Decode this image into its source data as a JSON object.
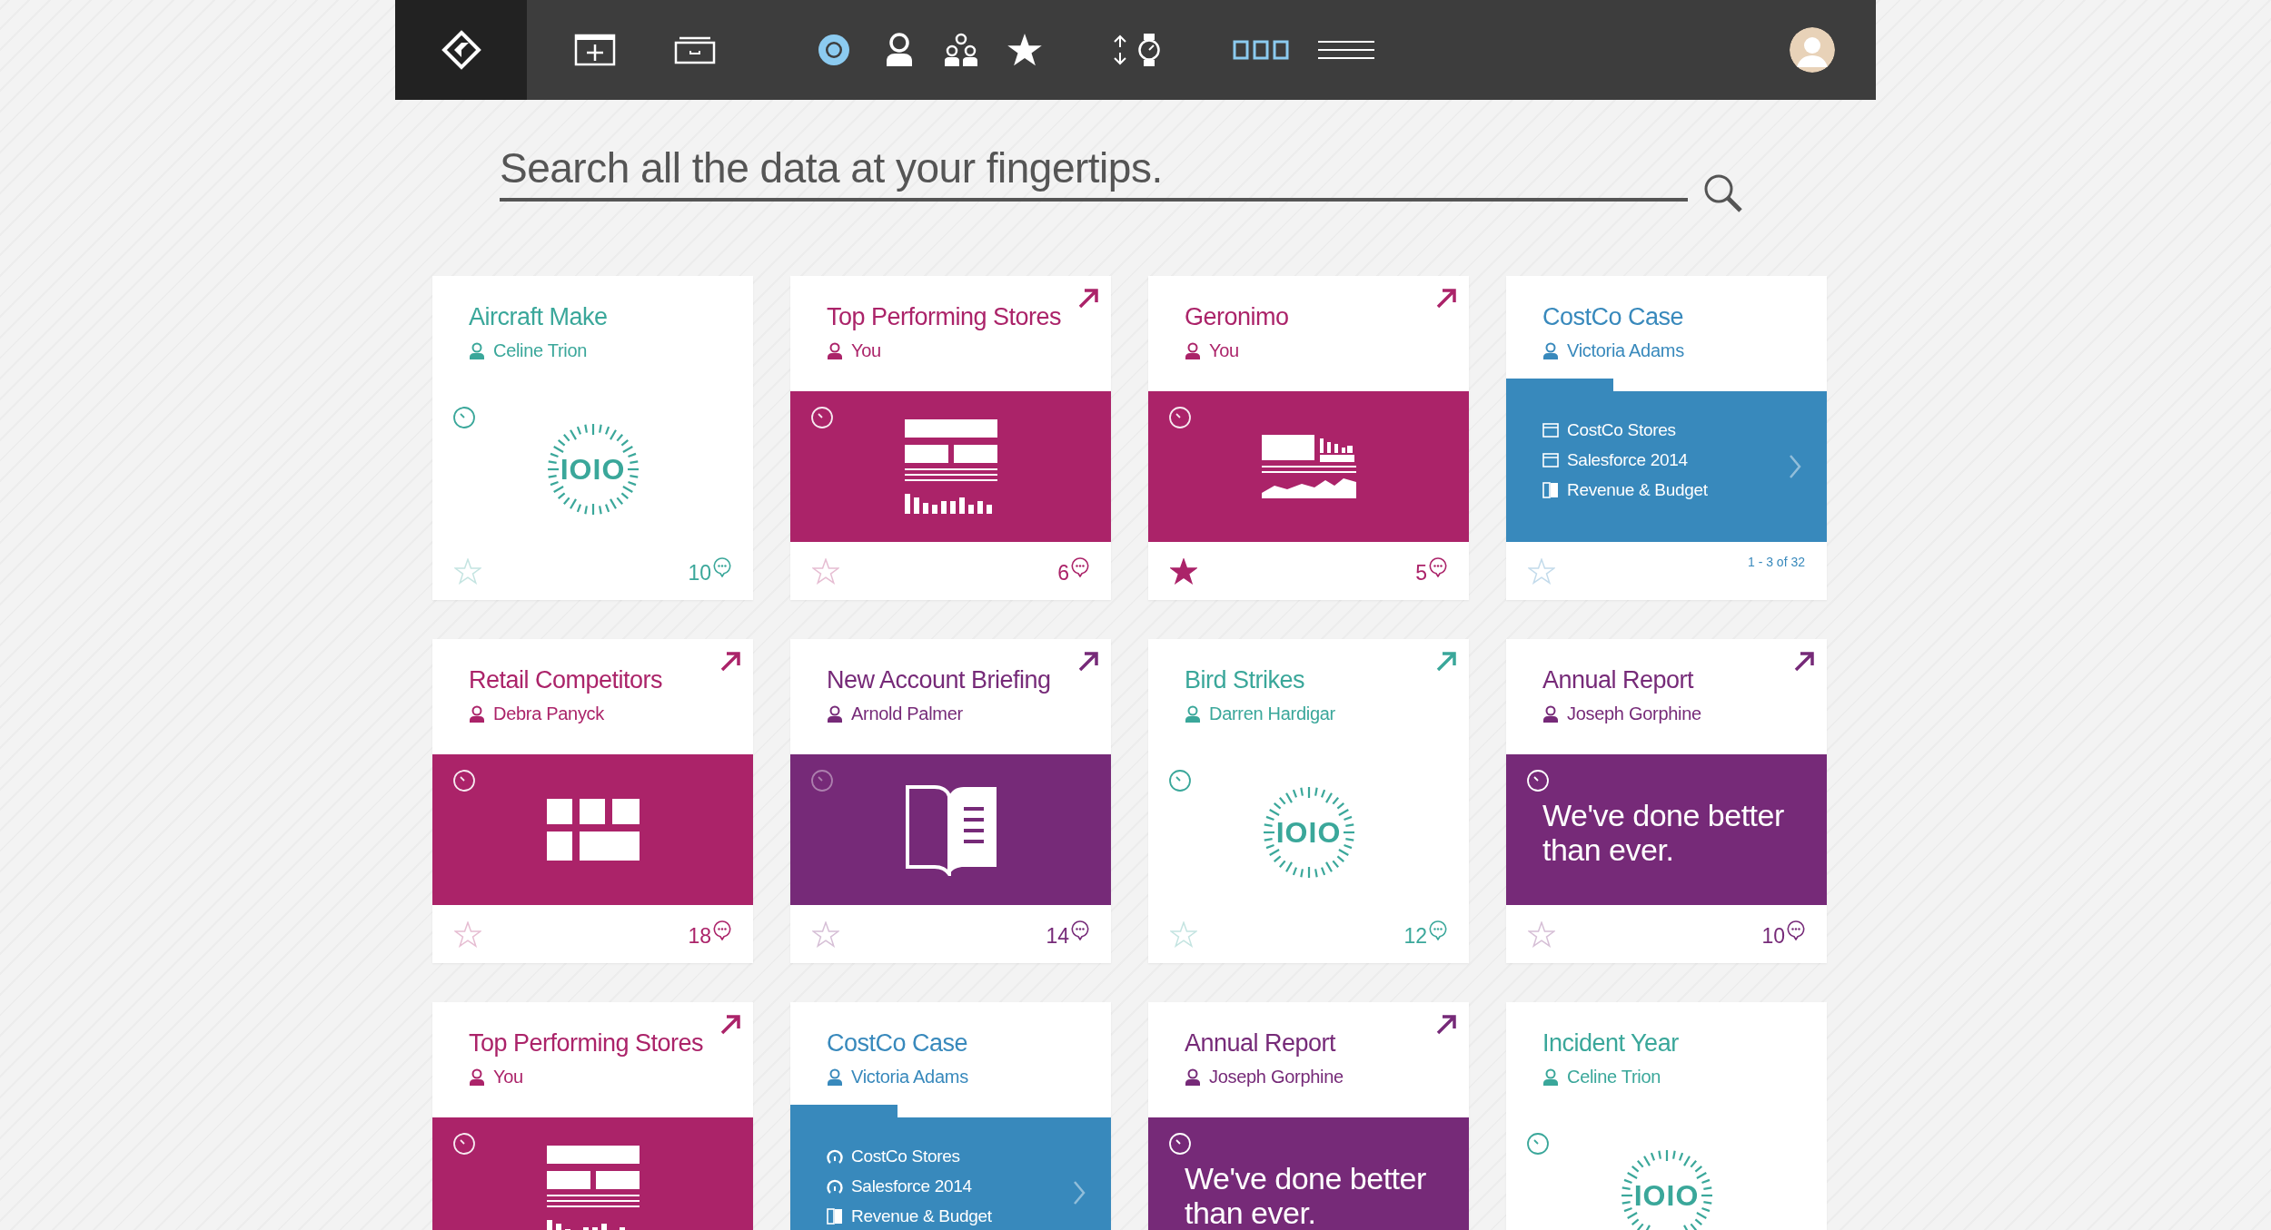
{
  "nav": {
    "items": [
      {
        "kind": "add-panel",
        "selected": false
      },
      {
        "kind": "tray",
        "selected": false
      },
      {
        "kind": "target",
        "selected": true
      },
      {
        "kind": "person",
        "selected": false
      },
      {
        "kind": "people",
        "selected": false
      },
      {
        "kind": "star",
        "selected": false
      },
      {
        "kind": "sort",
        "selected": false
      },
      {
        "kind": "watch",
        "selected": false
      },
      {
        "kind": "tiles",
        "selected": true
      },
      {
        "kind": "lines",
        "selected": false
      }
    ]
  },
  "search": {
    "placeholder": "Search all the data at your fingertips."
  },
  "cards": [
    {
      "kind": "stat",
      "color": "#3aa79a",
      "title": "Aircraft Make",
      "owner": "Celine Trion",
      "arrow": false,
      "dial_label": "IOIO",
      "starred": false,
      "count": "10"
    },
    {
      "kind": "layout",
      "color": "#ab2369",
      "title": "Top Performing Stores",
      "owner": "You",
      "arrow": true,
      "starred": false,
      "count": "6"
    },
    {
      "kind": "dashboard",
      "color": "#ab2369",
      "title": "Geronimo",
      "owner": "You",
      "arrow": true,
      "starred": true,
      "count": "5"
    },
    {
      "kind": "list",
      "color": "#3889bc",
      "title": "CostCo Case",
      "owner": "Victoria Adams",
      "arrow": false,
      "items": [
        {
          "kind": "window",
          "label": "CostCo Stores"
        },
        {
          "kind": "window",
          "label": "Salesforce 2014"
        },
        {
          "kind": "book",
          "label": "Revenue & Budget"
        }
      ],
      "starred": false,
      "pagination": "1 - 3 of 32"
    },
    {
      "kind": "tiles",
      "color": "#ab2369",
      "title": "Retail Competitors",
      "owner": "Debra Panyck",
      "arrow": true,
      "starred": false,
      "count": "18"
    },
    {
      "kind": "book",
      "color": "#762a78",
      "title": "New Account Briefing",
      "owner": "Arnold Palmer",
      "arrow": true,
      "starred": false,
      "count": "14"
    },
    {
      "kind": "stat",
      "color": "#3aa79a",
      "title": "Bird Strikes",
      "owner": "Darren Hardigar",
      "arrow": true,
      "dial_label": "IOIO",
      "starred": false,
      "count": "12"
    },
    {
      "kind": "quote",
      "color": "#762a78",
      "title": "Annual Report",
      "owner": "Joseph Gorphine",
      "arrow": true,
      "quote": "We've done better than ever.",
      "starred": false,
      "count": "10"
    },
    {
      "kind": "layout",
      "color": "#ab2369",
      "title": "Top Performing Stores",
      "owner": "You",
      "arrow": true
    },
    {
      "kind": "list",
      "color": "#3889bc",
      "title": "CostCo Case",
      "owner": "Victoria Adams",
      "arrow": false,
      "items": [
        {
          "kind": "gauge",
          "label": "CostCo Stores"
        },
        {
          "kind": "gauge",
          "label": "Salesforce 2014"
        },
        {
          "kind": "book",
          "label": "Revenue & Budget"
        }
      ]
    },
    {
      "kind": "quote",
      "color": "#762a78",
      "title": "Annual Report",
      "owner": "Joseph Gorphine",
      "arrow": true,
      "quote": "We've done better than ever."
    },
    {
      "kind": "stat",
      "color": "#3aa79a",
      "title": "Incident Year",
      "owner": "Celine Trion",
      "arrow": false,
      "dial_label": "IOIO"
    }
  ]
}
